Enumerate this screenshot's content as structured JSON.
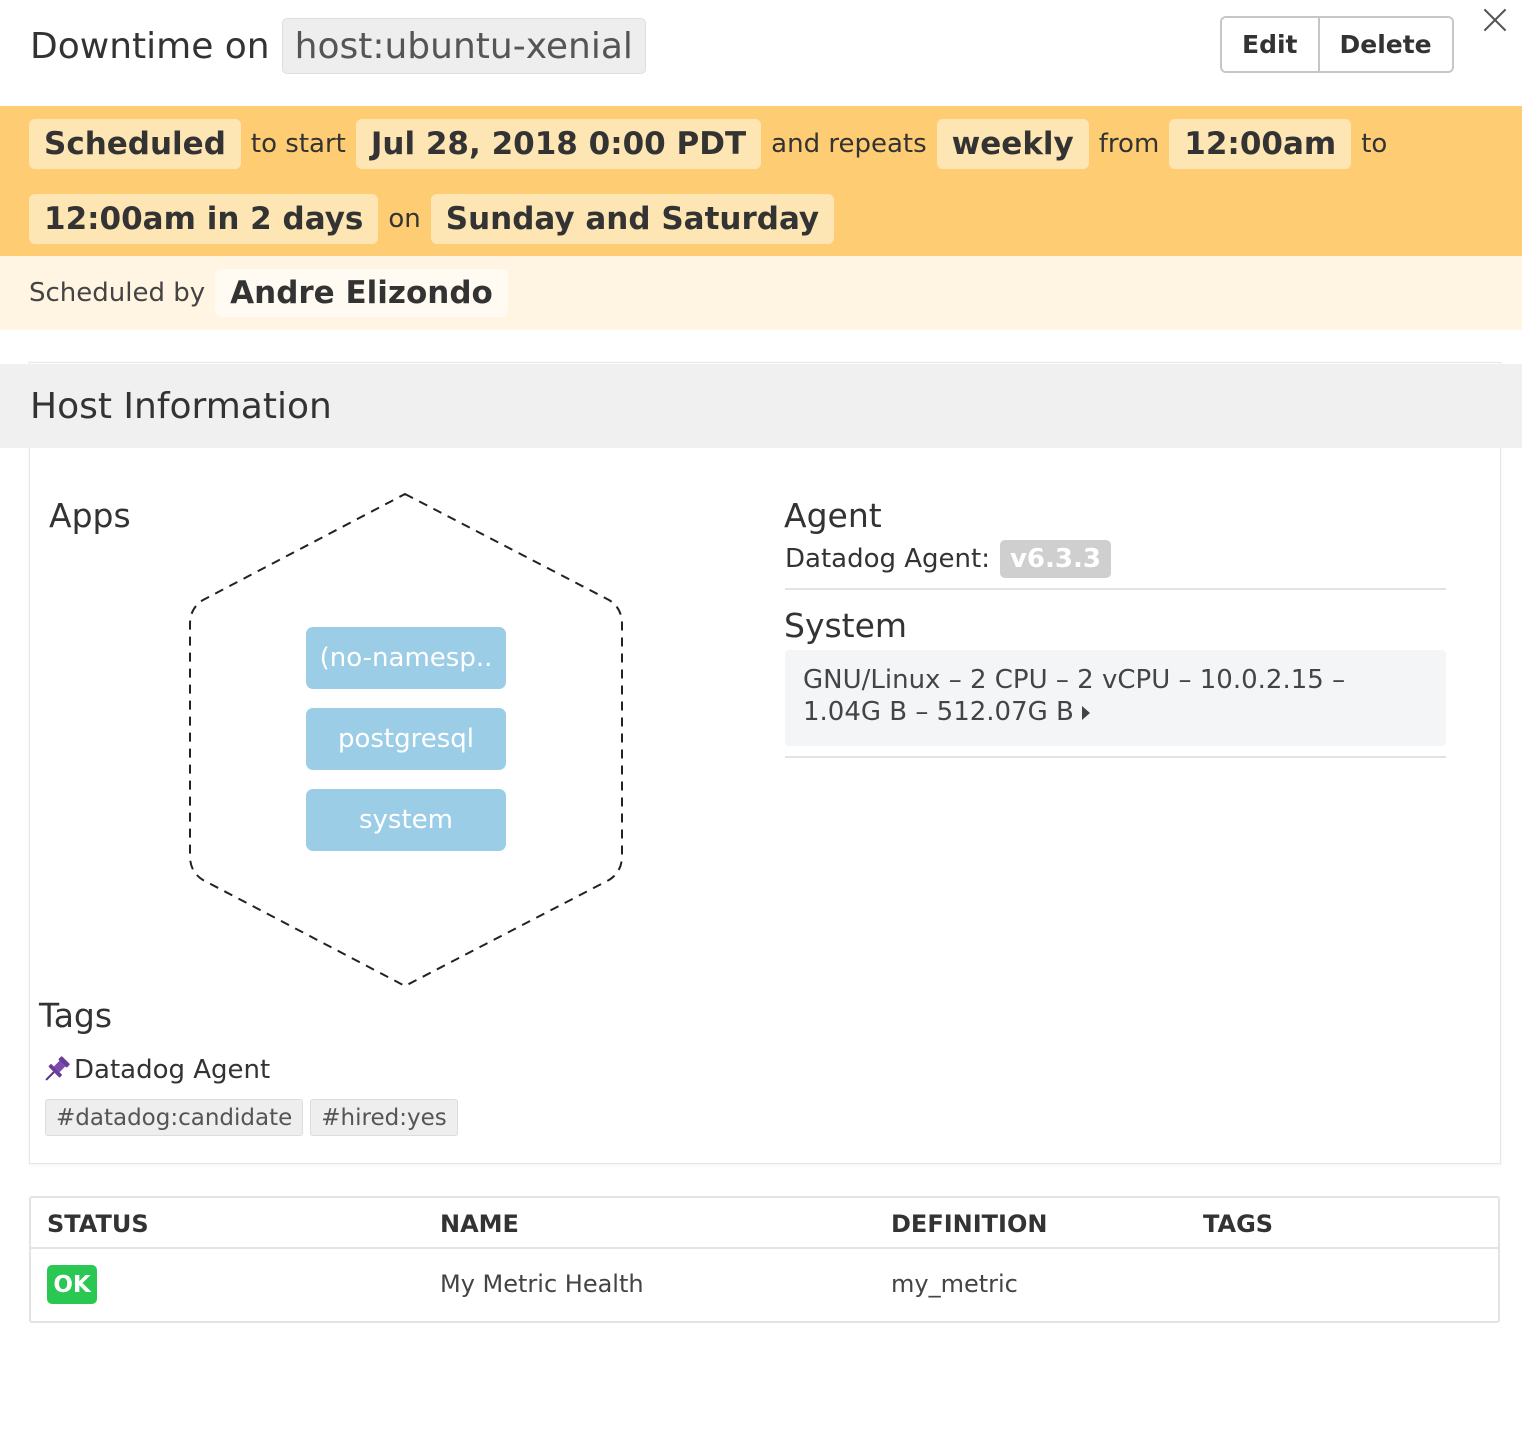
{
  "header": {
    "title": "Downtime on",
    "host": "host:ubuntu-xenial",
    "edit_label": "Edit",
    "delete_label": "Delete"
  },
  "schedule": {
    "status": "Scheduled",
    "to_start": "to start",
    "start": "Jul 28, 2018 0:00 PDT",
    "and_repeats": "and repeats",
    "frequency": "weekly",
    "from": "from",
    "from_time": "12:00am",
    "to": "to",
    "to_time": "12:00am in 2 days",
    "on": "on",
    "days": "Sunday and Saturday",
    "scheduled_by_label": "Scheduled by",
    "scheduled_by": "Andre Elizondo"
  },
  "host_info": {
    "title": "Host Information",
    "apps_title": "Apps",
    "apps": [
      "(no-namesp..",
      "postgresql",
      "system"
    ],
    "agent_title": "Agent",
    "agent_label": "Datadog Agent:",
    "agent_version": "v6.3.3",
    "system_title": "System",
    "system_line1": "GNU/Linux – 2 CPU – 2 vCPU – 10.0.2.15 –",
    "system_line2": "1.04G B – 512.07G B",
    "tags_title": "Tags",
    "tag_source": "Datadog Agent",
    "tags": [
      "#datadog:candidate",
      "#hired:yes"
    ]
  },
  "table": {
    "headers": [
      "STATUS",
      "NAME",
      "DEFINITION",
      "TAGS"
    ],
    "rows": [
      {
        "status": "OK",
        "name": "My Metric Health",
        "definition": "my_metric",
        "tags": ""
      }
    ]
  },
  "colors": {
    "schedule_band": "#fecd73",
    "byline_band": "#fff5e2",
    "app_pill": "#9ccde6",
    "ok": "#2bc753",
    "pin": "#6a3d9a"
  },
  "icons": {
    "close": "close-icon",
    "pin": "pin-icon",
    "caret": "caret-right-icon"
  }
}
